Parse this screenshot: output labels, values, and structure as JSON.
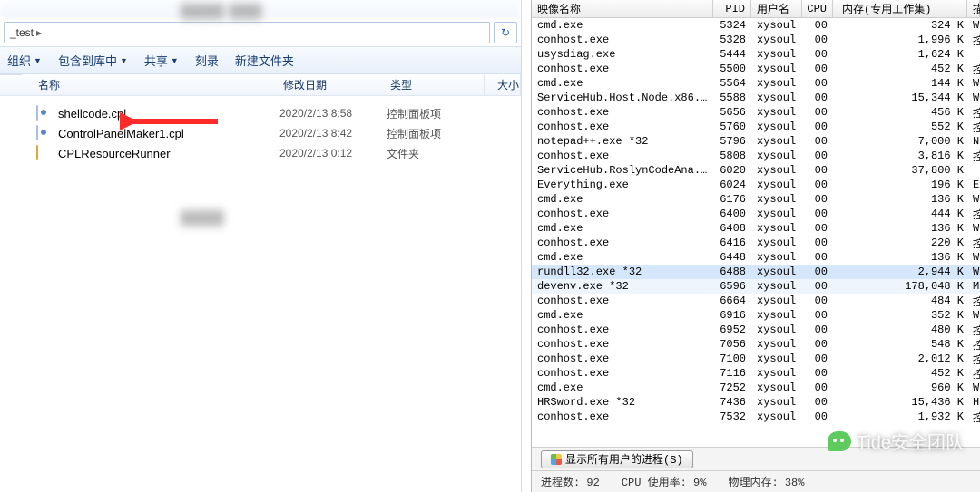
{
  "explorer": {
    "breadcrumb_tail": "_test",
    "refresh_glyph": "↻",
    "toolbar": {
      "organize": "组织",
      "include": "包含到库中",
      "share": "共享",
      "burn": "刻录",
      "new_folder": "新建文件夹"
    },
    "columns": {
      "name": "名称",
      "date": "修改日期",
      "type": "类型",
      "size": "大小"
    },
    "files": [
      {
        "icon": "cpl",
        "name": "shellcode.cpl",
        "date": "2020/2/13 8:58",
        "type": "控制面板项"
      },
      {
        "icon": "cpl",
        "name": "ControlPanelMaker1.cpl",
        "date": "2020/2/13 8:42",
        "type": "控制面板项"
      },
      {
        "icon": "folder",
        "name": "CPLResourceRunner",
        "date": "2020/2/13 0:12",
        "type": "文件夹"
      }
    ]
  },
  "taskmgr": {
    "columns": {
      "proc": "映像名称",
      "pid": "PID",
      "user": "用户名",
      "cpu": "CPU",
      "mem": "内存(专用工作集)",
      "ext": "描"
    },
    "processes": [
      {
        "proc": "cmd.exe",
        "pid": "5324",
        "user": "xysoul",
        "cpu": "00",
        "mem": "324 K",
        "ext": "W"
      },
      {
        "proc": "conhost.exe",
        "pid": "5328",
        "user": "xysoul",
        "cpu": "00",
        "mem": "1,996 K",
        "ext": "控"
      },
      {
        "proc": "usysdiag.exe",
        "pid": "5444",
        "user": "xysoul",
        "cpu": "00",
        "mem": "1,624 K",
        "ext": ""
      },
      {
        "proc": "conhost.exe",
        "pid": "5500",
        "user": "xysoul",
        "cpu": "00",
        "mem": "452 K",
        "ext": "控"
      },
      {
        "proc": "cmd.exe",
        "pid": "5564",
        "user": "xysoul",
        "cpu": "00",
        "mem": "144 K",
        "ext": "W"
      },
      {
        "proc": "ServiceHub.Host.Node.x86...",
        "pid": "5588",
        "user": "xysoul",
        "cpu": "00",
        "mem": "15,344 K",
        "ext": "W"
      },
      {
        "proc": "conhost.exe",
        "pid": "5656",
        "user": "xysoul",
        "cpu": "00",
        "mem": "456 K",
        "ext": "控"
      },
      {
        "proc": "conhost.exe",
        "pid": "5760",
        "user": "xysoul",
        "cpu": "00",
        "mem": "552 K",
        "ext": "控"
      },
      {
        "proc": "notepad++.exe *32",
        "pid": "5796",
        "user": "xysoul",
        "cpu": "00",
        "mem": "7,000 K",
        "ext": "N"
      },
      {
        "proc": "conhost.exe",
        "pid": "5808",
        "user": "xysoul",
        "cpu": "00",
        "mem": "3,816 K",
        "ext": "控"
      },
      {
        "proc": "ServiceHub.RoslynCodeAna...",
        "pid": "6020",
        "user": "xysoul",
        "cpu": "00",
        "mem": "37,800 K",
        "ext": ""
      },
      {
        "proc": "Everything.exe",
        "pid": "6024",
        "user": "xysoul",
        "cpu": "00",
        "mem": "196 K",
        "ext": "E"
      },
      {
        "proc": "cmd.exe",
        "pid": "6176",
        "user": "xysoul",
        "cpu": "00",
        "mem": "136 K",
        "ext": "W"
      },
      {
        "proc": "conhost.exe",
        "pid": "6400",
        "user": "xysoul",
        "cpu": "00",
        "mem": "444 K",
        "ext": "控"
      },
      {
        "proc": "cmd.exe",
        "pid": "6408",
        "user": "xysoul",
        "cpu": "00",
        "mem": "136 K",
        "ext": "W"
      },
      {
        "proc": "conhost.exe",
        "pid": "6416",
        "user": "xysoul",
        "cpu": "00",
        "mem": "220 K",
        "ext": "控"
      },
      {
        "proc": "cmd.exe",
        "pid": "6448",
        "user": "xysoul",
        "cpu": "00",
        "mem": "136 K",
        "ext": "W"
      },
      {
        "proc": "rundll32.exe *32",
        "pid": "6488",
        "user": "xysoul",
        "cpu": "00",
        "mem": "2,944 K",
        "ext": "W",
        "sel": true
      },
      {
        "proc": "devenv.exe *32",
        "pid": "6596",
        "user": "xysoul",
        "cpu": "00",
        "mem": "178,048 K",
        "ext": "M",
        "sel2": true
      },
      {
        "proc": "conhost.exe",
        "pid": "6664",
        "user": "xysoul",
        "cpu": "00",
        "mem": "484 K",
        "ext": "控"
      },
      {
        "proc": "cmd.exe",
        "pid": "6916",
        "user": "xysoul",
        "cpu": "00",
        "mem": "352 K",
        "ext": "W"
      },
      {
        "proc": "conhost.exe",
        "pid": "6952",
        "user": "xysoul",
        "cpu": "00",
        "mem": "480 K",
        "ext": "控"
      },
      {
        "proc": "conhost.exe",
        "pid": "7056",
        "user": "xysoul",
        "cpu": "00",
        "mem": "548 K",
        "ext": "控"
      },
      {
        "proc": "conhost.exe",
        "pid": "7100",
        "user": "xysoul",
        "cpu": "00",
        "mem": "2,012 K",
        "ext": "控"
      },
      {
        "proc": "conhost.exe",
        "pid": "7116",
        "user": "xysoul",
        "cpu": "00",
        "mem": "452 K",
        "ext": "控"
      },
      {
        "proc": "cmd.exe",
        "pid": "7252",
        "user": "xysoul",
        "cpu": "00",
        "mem": "960 K",
        "ext": "W"
      },
      {
        "proc": "HRSword.exe *32",
        "pid": "7436",
        "user": "xysoul",
        "cpu": "00",
        "mem": "15,436 K",
        "ext": "H"
      },
      {
        "proc": "conhost.exe",
        "pid": "7532",
        "user": "xysoul",
        "cpu": "00",
        "mem": "1,932 K",
        "ext": "控"
      }
    ],
    "show_all": "显示所有用户的进程(S)",
    "status": {
      "procs": "进程数: 92",
      "cpu": "CPU 使用率: 9%",
      "mem": "物理内存: 38%"
    }
  },
  "watermark": "Tide安全团队",
  "colors": {
    "arrow": "#ff2a2a"
  }
}
